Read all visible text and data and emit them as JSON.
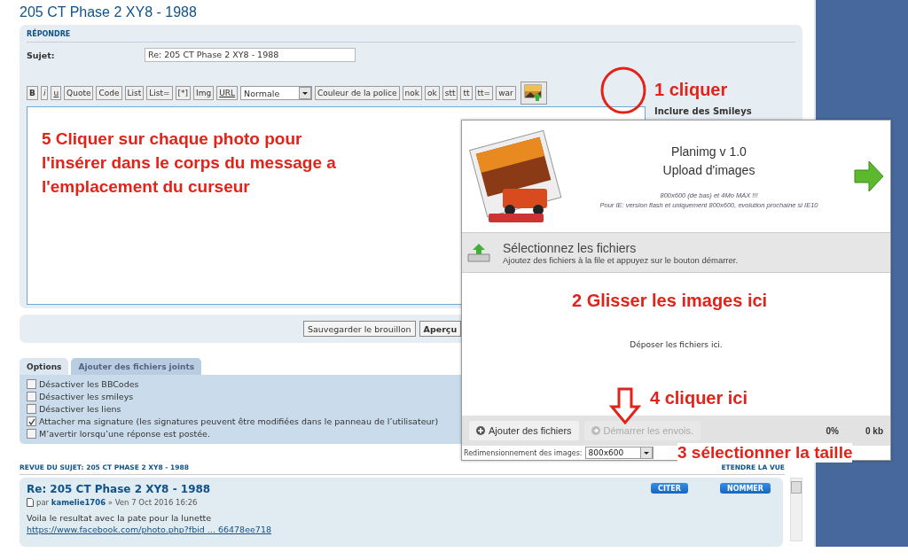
{
  "page_title": "205 CT Phase 2 XY8 - 1988",
  "reply": {
    "heading": "RÉPONDRE",
    "subject_label": "Sujet:",
    "subject_value": "Re: 205 CT Phase 2 XY8 - 1988",
    "toolbar": [
      {
        "kind": "bold",
        "label": "B"
      },
      {
        "kind": "italic",
        "label": "i"
      },
      {
        "kind": "underline",
        "label": "u"
      },
      {
        "kind": "plain",
        "label": "Quote"
      },
      {
        "kind": "plain",
        "label": "Code"
      },
      {
        "kind": "plain",
        "label": "List"
      },
      {
        "kind": "plain",
        "label": "List="
      },
      {
        "kind": "plain",
        "label": "[*]"
      },
      {
        "kind": "plain",
        "label": "Img"
      },
      {
        "kind": "underline",
        "label": "URL"
      },
      {
        "kind": "select",
        "label": "Normale"
      },
      {
        "kind": "plain",
        "label": "Couleur de la police"
      },
      {
        "kind": "plain",
        "label": "nok"
      },
      {
        "kind": "plain",
        "label": "ok"
      },
      {
        "kind": "plain",
        "label": "stt"
      },
      {
        "kind": "plain",
        "label": "tt"
      },
      {
        "kind": "plain",
        "label": "tt="
      },
      {
        "kind": "plain",
        "label": "war"
      },
      {
        "kind": "image-upload"
      }
    ],
    "smileys_heading": "Inclure des Smileys",
    "actions": [
      {
        "label": "Sauvegarder le brouillon",
        "primary": false
      },
      {
        "label": "Aperçu",
        "primary": true
      }
    ]
  },
  "tabs": [
    {
      "label": "Options",
      "selected": true
    },
    {
      "label": "Ajouter des fichiers joints",
      "selected": false
    }
  ],
  "options": [
    {
      "label": "Désactiver les BBCodes",
      "checked": false
    },
    {
      "label": "Désactiver les smileys",
      "checked": false
    },
    {
      "label": "Désactiver les liens",
      "checked": false
    },
    {
      "label": "Attacher ma signature (les signatures peuvent être modifiées dans le panneau de l’utilisateur)",
      "checked": true
    },
    {
      "label": "M’avertir lorsqu’une réponse est postée.",
      "checked": false
    }
  ],
  "review": {
    "heading": "REVUE DU SUJET: 205 CT PHASE 2 XY8 - 1988",
    "expand_link": "ETENDRE LA VUE",
    "post": {
      "title": "Re: 205 CT Phase 2 XY8 - 1988",
      "byline": "par **kamelie1706** » Ven 7 Oct 2016 16:26",
      "body": "Voila le resultat avec la pate pour la lunette",
      "link": "https://www.facebook.com/photo.php?fbid ... 66478ee718",
      "quote_button": "CITER",
      "name_button": "NOMMER"
    }
  },
  "uploader": {
    "title_lines": [
      "Planimg v 1.0",
      "Upload d'images"
    ],
    "notes": [
      "800x600 (de bas) et 4Mo MAX !!!",
      "Pour IE: version flash et uniquement 800x600, evolution prochaine si IE10"
    ],
    "select_title": "Sélectionnez les fichiers",
    "select_hint": "Ajoutez des fichiers à la file et appuyez sur le bouton démarrer.",
    "drop_hint": "Déposer les fichiers ici.",
    "add_button": "Ajouter des fichiers",
    "start_button": "Démarrer les envois.",
    "start_disabled": true,
    "percent": "0%",
    "size": "0 kb",
    "resize_label": "Redimensionnement des images:",
    "resize_value": "800x600"
  },
  "annotations": {
    "click_button": "1 cliquer",
    "drag_here": "2 Glisser les images ici",
    "choose_size": "3 sélectionner la taille",
    "click_start": "4 cliquer ici",
    "click_photo": "5 Cliquer sur chaque photo pour l'insérer dans le corps du message a l'emplacement du curseur"
  }
}
